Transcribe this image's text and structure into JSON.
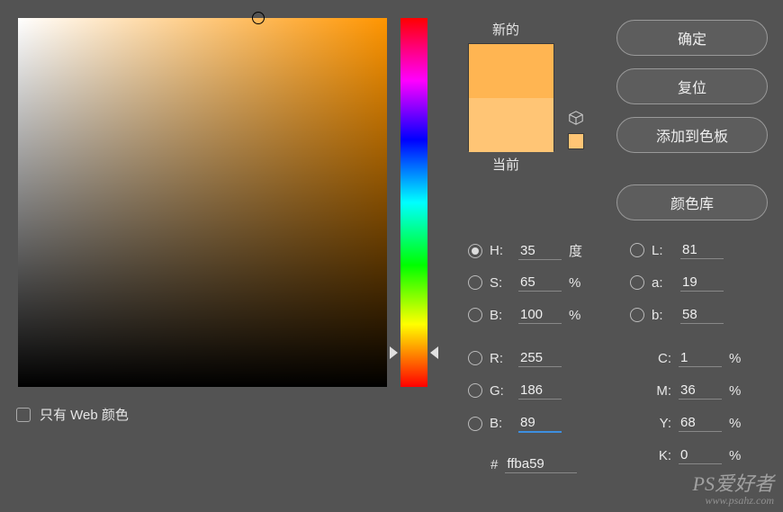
{
  "preview": {
    "new_label": "新的",
    "current_label": "当前"
  },
  "buttons": {
    "ok": "确定",
    "reset": "复位",
    "add_swatch": "添加到色板",
    "library": "颜色库"
  },
  "web_only_label": "只有 Web 颜色",
  "hsb": {
    "h": {
      "label": "H:",
      "value": "35",
      "unit": "度"
    },
    "s": {
      "label": "S:",
      "value": "65",
      "unit": "%"
    },
    "b": {
      "label": "B:",
      "value": "100",
      "unit": "%"
    }
  },
  "rgb": {
    "r": {
      "label": "R:",
      "value": "255"
    },
    "g": {
      "label": "G:",
      "value": "186"
    },
    "b": {
      "label": "B:",
      "value": "89"
    }
  },
  "lab": {
    "l": {
      "label": "L:",
      "value": "81"
    },
    "a": {
      "label": "a:",
      "value": "19"
    },
    "b": {
      "label": "b:",
      "value": "58"
    }
  },
  "cmyk": {
    "c": {
      "label": "C:",
      "value": "1",
      "unit": "%"
    },
    "m": {
      "label": "M:",
      "value": "36",
      "unit": "%"
    },
    "y": {
      "label": "Y:",
      "value": "68",
      "unit": "%"
    },
    "k": {
      "label": "K:",
      "value": "0",
      "unit": "%"
    }
  },
  "hex": {
    "prefix": "#",
    "value": "ffba59"
  },
  "watermark": {
    "line1": "PS爱好者",
    "line2": "www.psahz.com"
  },
  "colors": {
    "new": "#ffb552",
    "current": "#ffc575",
    "hue_pos_pct": 90.3
  }
}
